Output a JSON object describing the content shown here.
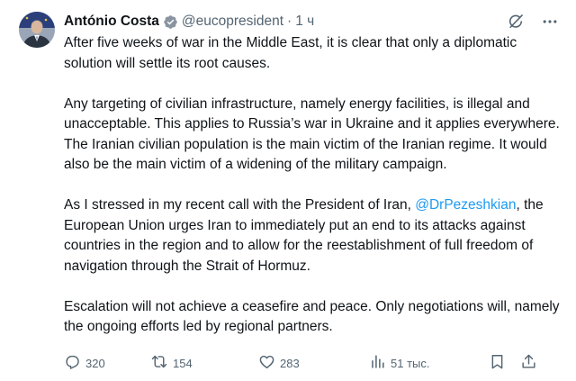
{
  "author": {
    "name": "António Costa",
    "handle": "@eucopresident",
    "separator": "·",
    "time": "1 ч"
  },
  "body": {
    "p1": "After five weeks of war in the Middle East, it is clear that only a diplomatic solution will settle its root causes.",
    "p2": "Any targeting of civilian infrastructure, namely energy facilities, is illegal and unacceptable. This applies to Russia’s war in Ukraine and it applies everywhere. The Iranian civilian population is the main victim of the Iranian regime. It would also be the main victim of a widening of the military campaign.",
    "p3_before": "As I stressed in my recent call with the President of Iran, ",
    "p3_mention": "@DrPezeshkian",
    "p3_after": ", the European Union urges Iran to immediately put an end to its attacks against countries in the region and to allow for the reestablishment of full freedom of navigation through the Strait of Hormuz.",
    "p4": "Escalation will not achieve a ceasefire and peace. Only negotiations will, namely the ongoing efforts led by regional partners."
  },
  "actions": {
    "replies": "320",
    "reposts": "154",
    "likes": "283",
    "views": "51 тыс."
  },
  "icons": {
    "verified": "verified-badge-icon",
    "grok": "grok-icon",
    "more": "more-options-icon",
    "reply": "reply-icon",
    "repost": "repost-icon",
    "like": "heart-icon",
    "views": "views-icon",
    "bookmark": "bookmark-icon",
    "share": "share-icon"
  },
  "colors": {
    "text": "#0f1419",
    "secondary": "#536471",
    "link": "#1d9bf0",
    "verified": "#8a94a0"
  }
}
